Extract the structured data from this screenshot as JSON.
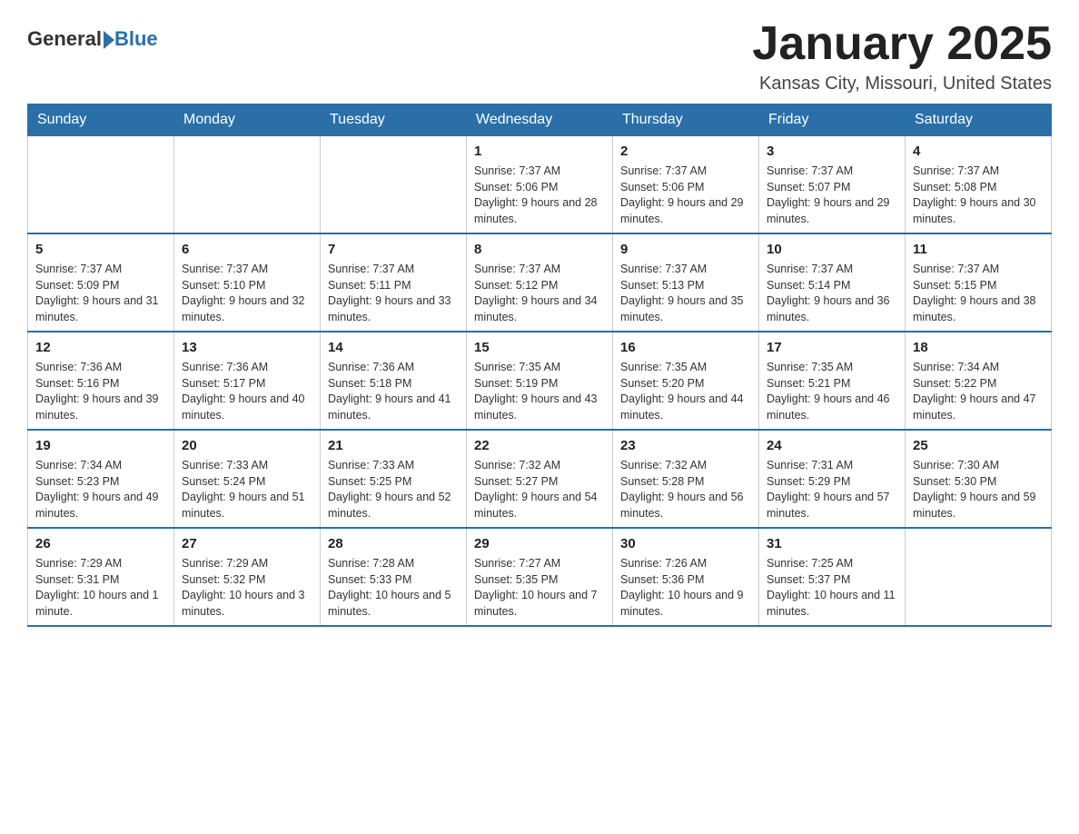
{
  "header": {
    "logo_text1": "General",
    "logo_text2": "Blue",
    "title": "January 2025",
    "subtitle": "Kansas City, Missouri, United States"
  },
  "calendar": {
    "days_of_week": [
      "Sunday",
      "Monday",
      "Tuesday",
      "Wednesday",
      "Thursday",
      "Friday",
      "Saturday"
    ],
    "weeks": [
      [
        {
          "day": "",
          "sunrise": "",
          "sunset": "",
          "daylight": ""
        },
        {
          "day": "",
          "sunrise": "",
          "sunset": "",
          "daylight": ""
        },
        {
          "day": "",
          "sunrise": "",
          "sunset": "",
          "daylight": ""
        },
        {
          "day": "1",
          "sunrise": "Sunrise: 7:37 AM",
          "sunset": "Sunset: 5:06 PM",
          "daylight": "Daylight: 9 hours and 28 minutes."
        },
        {
          "day": "2",
          "sunrise": "Sunrise: 7:37 AM",
          "sunset": "Sunset: 5:06 PM",
          "daylight": "Daylight: 9 hours and 29 minutes."
        },
        {
          "day": "3",
          "sunrise": "Sunrise: 7:37 AM",
          "sunset": "Sunset: 5:07 PM",
          "daylight": "Daylight: 9 hours and 29 minutes."
        },
        {
          "day": "4",
          "sunrise": "Sunrise: 7:37 AM",
          "sunset": "Sunset: 5:08 PM",
          "daylight": "Daylight: 9 hours and 30 minutes."
        }
      ],
      [
        {
          "day": "5",
          "sunrise": "Sunrise: 7:37 AM",
          "sunset": "Sunset: 5:09 PM",
          "daylight": "Daylight: 9 hours and 31 minutes."
        },
        {
          "day": "6",
          "sunrise": "Sunrise: 7:37 AM",
          "sunset": "Sunset: 5:10 PM",
          "daylight": "Daylight: 9 hours and 32 minutes."
        },
        {
          "day": "7",
          "sunrise": "Sunrise: 7:37 AM",
          "sunset": "Sunset: 5:11 PM",
          "daylight": "Daylight: 9 hours and 33 minutes."
        },
        {
          "day": "8",
          "sunrise": "Sunrise: 7:37 AM",
          "sunset": "Sunset: 5:12 PM",
          "daylight": "Daylight: 9 hours and 34 minutes."
        },
        {
          "day": "9",
          "sunrise": "Sunrise: 7:37 AM",
          "sunset": "Sunset: 5:13 PM",
          "daylight": "Daylight: 9 hours and 35 minutes."
        },
        {
          "day": "10",
          "sunrise": "Sunrise: 7:37 AM",
          "sunset": "Sunset: 5:14 PM",
          "daylight": "Daylight: 9 hours and 36 minutes."
        },
        {
          "day": "11",
          "sunrise": "Sunrise: 7:37 AM",
          "sunset": "Sunset: 5:15 PM",
          "daylight": "Daylight: 9 hours and 38 minutes."
        }
      ],
      [
        {
          "day": "12",
          "sunrise": "Sunrise: 7:36 AM",
          "sunset": "Sunset: 5:16 PM",
          "daylight": "Daylight: 9 hours and 39 minutes."
        },
        {
          "day": "13",
          "sunrise": "Sunrise: 7:36 AM",
          "sunset": "Sunset: 5:17 PM",
          "daylight": "Daylight: 9 hours and 40 minutes."
        },
        {
          "day": "14",
          "sunrise": "Sunrise: 7:36 AM",
          "sunset": "Sunset: 5:18 PM",
          "daylight": "Daylight: 9 hours and 41 minutes."
        },
        {
          "day": "15",
          "sunrise": "Sunrise: 7:35 AM",
          "sunset": "Sunset: 5:19 PM",
          "daylight": "Daylight: 9 hours and 43 minutes."
        },
        {
          "day": "16",
          "sunrise": "Sunrise: 7:35 AM",
          "sunset": "Sunset: 5:20 PM",
          "daylight": "Daylight: 9 hours and 44 minutes."
        },
        {
          "day": "17",
          "sunrise": "Sunrise: 7:35 AM",
          "sunset": "Sunset: 5:21 PM",
          "daylight": "Daylight: 9 hours and 46 minutes."
        },
        {
          "day": "18",
          "sunrise": "Sunrise: 7:34 AM",
          "sunset": "Sunset: 5:22 PM",
          "daylight": "Daylight: 9 hours and 47 minutes."
        }
      ],
      [
        {
          "day": "19",
          "sunrise": "Sunrise: 7:34 AM",
          "sunset": "Sunset: 5:23 PM",
          "daylight": "Daylight: 9 hours and 49 minutes."
        },
        {
          "day": "20",
          "sunrise": "Sunrise: 7:33 AM",
          "sunset": "Sunset: 5:24 PM",
          "daylight": "Daylight: 9 hours and 51 minutes."
        },
        {
          "day": "21",
          "sunrise": "Sunrise: 7:33 AM",
          "sunset": "Sunset: 5:25 PM",
          "daylight": "Daylight: 9 hours and 52 minutes."
        },
        {
          "day": "22",
          "sunrise": "Sunrise: 7:32 AM",
          "sunset": "Sunset: 5:27 PM",
          "daylight": "Daylight: 9 hours and 54 minutes."
        },
        {
          "day": "23",
          "sunrise": "Sunrise: 7:32 AM",
          "sunset": "Sunset: 5:28 PM",
          "daylight": "Daylight: 9 hours and 56 minutes."
        },
        {
          "day": "24",
          "sunrise": "Sunrise: 7:31 AM",
          "sunset": "Sunset: 5:29 PM",
          "daylight": "Daylight: 9 hours and 57 minutes."
        },
        {
          "day": "25",
          "sunrise": "Sunrise: 7:30 AM",
          "sunset": "Sunset: 5:30 PM",
          "daylight": "Daylight: 9 hours and 59 minutes."
        }
      ],
      [
        {
          "day": "26",
          "sunrise": "Sunrise: 7:29 AM",
          "sunset": "Sunset: 5:31 PM",
          "daylight": "Daylight: 10 hours and 1 minute."
        },
        {
          "day": "27",
          "sunrise": "Sunrise: 7:29 AM",
          "sunset": "Sunset: 5:32 PM",
          "daylight": "Daylight: 10 hours and 3 minutes."
        },
        {
          "day": "28",
          "sunrise": "Sunrise: 7:28 AM",
          "sunset": "Sunset: 5:33 PM",
          "daylight": "Daylight: 10 hours and 5 minutes."
        },
        {
          "day": "29",
          "sunrise": "Sunrise: 7:27 AM",
          "sunset": "Sunset: 5:35 PM",
          "daylight": "Daylight: 10 hours and 7 minutes."
        },
        {
          "day": "30",
          "sunrise": "Sunrise: 7:26 AM",
          "sunset": "Sunset: 5:36 PM",
          "daylight": "Daylight: 10 hours and 9 minutes."
        },
        {
          "day": "31",
          "sunrise": "Sunrise: 7:25 AM",
          "sunset": "Sunset: 5:37 PM",
          "daylight": "Daylight: 10 hours and 11 minutes."
        },
        {
          "day": "",
          "sunrise": "",
          "sunset": "",
          "daylight": ""
        }
      ]
    ]
  }
}
